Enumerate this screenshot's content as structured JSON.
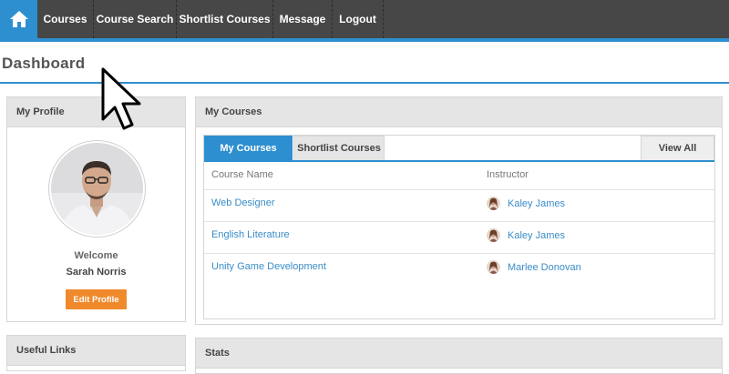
{
  "nav": {
    "items": [
      {
        "label": "Courses"
      },
      {
        "label": "Course Search"
      },
      {
        "label": "Shortlist Courses"
      },
      {
        "label": "Message"
      },
      {
        "label": "Logout"
      }
    ]
  },
  "page": {
    "title": "Dashboard"
  },
  "profile": {
    "heading": "My Profile",
    "welcome": "Welcome",
    "name": "Sarah Norris",
    "edit_label": "Edit Profile"
  },
  "courses": {
    "heading": "My Courses",
    "tabs": [
      {
        "label": "My Courses",
        "active": true
      },
      {
        "label": "Shortlist Courses",
        "active": false
      }
    ],
    "view_all": "View All",
    "columns": {
      "course": "Course Name",
      "instructor": "Instructor"
    },
    "rows": [
      {
        "course": "Web Designer",
        "instructor": "Kaley James"
      },
      {
        "course": "English Literature",
        "instructor": "Kaley James"
      },
      {
        "course": "Unity Game Development",
        "instructor": "Marlee Donovan"
      }
    ]
  },
  "useful_links": {
    "heading": "Useful Links"
  },
  "stats": {
    "heading": "Stats"
  },
  "colors": {
    "accent": "#2e8fd0",
    "nav_bg": "#474747",
    "button_orange": "#f0892c",
    "link": "#3a8cc6"
  },
  "icons": {
    "home": "home-icon",
    "cursor": "mouse-pointer-icon"
  }
}
